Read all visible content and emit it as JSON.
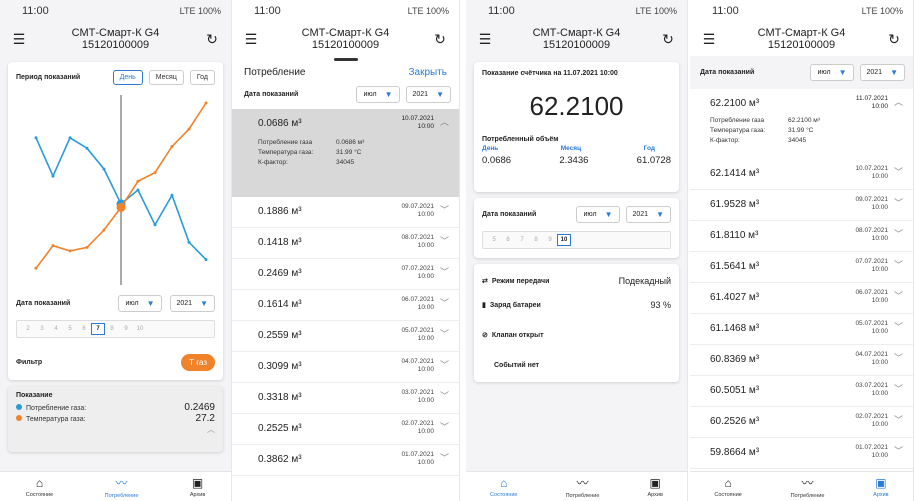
{
  "device": "СМТ-Смарт-К G4",
  "serial": "15120100009",
  "status": {
    "time": "11:00",
    "net": "LTE 100%"
  },
  "screen1": {
    "period_label": "Период показаний",
    "tabs": [
      "День",
      "Месяц",
      "Год"
    ],
    "date_label": "Дата показаний",
    "month": "июл",
    "year": "2021",
    "days": [
      "2",
      "3",
      "4",
      "5",
      "6",
      "7",
      "8",
      "9",
      "10"
    ],
    "active_day": "7",
    "filter_label": "Фильтр",
    "filter_button": "Т газ",
    "reading_title": "Показание",
    "readings": [
      {
        "name": "Потребление газа:",
        "value": "0.2469",
        "color": "#2a9bd8"
      },
      {
        "name": "Температура газа:",
        "value": "27.2",
        "color": "#f0822a"
      }
    ],
    "chart_data": {
      "type": "line",
      "series": [
        {
          "color": "#2a9bd8",
          "values": [
            0.8,
            0.58,
            0.8,
            0.74,
            0.62,
            0.42,
            0.5,
            0.3,
            0.47,
            0.2,
            0.1
          ]
        },
        {
          "color": "#f0822a",
          "values": [
            0.05,
            0.18,
            0.15,
            0.17,
            0.27,
            0.4,
            0.55,
            0.6,
            0.75,
            0.85,
            1.0
          ]
        }
      ]
    }
  },
  "screen2": {
    "title": "Потребление",
    "close": "Закрыть",
    "date_label": "Дата показаний",
    "month": "июл",
    "year": "2021",
    "expanded": {
      "value": "0.0686 м³",
      "date": "10.07.2021",
      "time": "10:00",
      "details": [
        {
          "k": "Потребление газа",
          "v": "0.0686 м³"
        },
        {
          "k": "Температура газа:",
          "v": "31.99 °C"
        },
        {
          "k": "К-фактор:",
          "v": "34045"
        }
      ]
    },
    "rows": [
      {
        "value": "0.1886 м³",
        "date": "09.07.2021",
        "time": "10:00"
      },
      {
        "value": "0.1418 м³",
        "date": "08.07.2021",
        "time": "10:00"
      },
      {
        "value": "0.2469 м³",
        "date": "07.07.2021",
        "time": "10:00"
      },
      {
        "value": "0.1614 м³",
        "date": "06.07.2021",
        "time": "10:00"
      },
      {
        "value": "0.2559 м³",
        "date": "05.07.2021",
        "time": "10:00"
      },
      {
        "value": "0.3099 м³",
        "date": "04.07.2021",
        "time": "10:00"
      },
      {
        "value": "0.3318 м³",
        "date": "03.07.2021",
        "time": "10:00"
      },
      {
        "value": "0.2525 м³",
        "date": "02.07.2021",
        "time": "10:00"
      },
      {
        "value": "0.3862 м³",
        "date": "01.07.2021",
        "time": "10:00"
      }
    ]
  },
  "screen3": {
    "meter_label": "Показание счётчика на 11.07.2021 10:00",
    "meter_value": "62.2100",
    "volume_label": "Потребленный объём",
    "cols": [
      {
        "h": "День",
        "v": "0.0686"
      },
      {
        "h": "Месяц",
        "v": "2.3436"
      },
      {
        "h": "Год",
        "v": "61.0728"
      }
    ],
    "date_label": "Дата показаний",
    "month": "июл",
    "year": "2021",
    "days": [
      "5",
      "6",
      "7",
      "8",
      "9",
      "10"
    ],
    "active_day": "10",
    "mode_label": "Режим передачи",
    "mode_value": "Подекадный",
    "battery_label": "Заряд батареи",
    "battery_value": "93 %",
    "valve_label": "Клапан открыт",
    "events_label": "Событий нет"
  },
  "screen4": {
    "date_label": "Дата показаний",
    "month": "июл",
    "year": "2021",
    "expanded": {
      "value": "62.2100 м³",
      "date": "11.07.2021",
      "time": "10:00",
      "details": [
        {
          "k": "Потребление газа",
          "v": "62.2100 м³"
        },
        {
          "k": "Температура газа:",
          "v": "31.99 °C"
        },
        {
          "k": "К-фактор:",
          "v": "34045"
        }
      ]
    },
    "rows": [
      {
        "value": "62.1414 м³",
        "date": "10.07.2021",
        "time": "10:00"
      },
      {
        "value": "61.9528 м³",
        "date": "09.07.2021",
        "time": "10:00"
      },
      {
        "value": "61.8110 м³",
        "date": "08.07.2021",
        "time": "10:00"
      },
      {
        "value": "61.5641 м³",
        "date": "07.07.2021",
        "time": "10:00"
      },
      {
        "value": "61.4027 м³",
        "date": "06.07.2021",
        "time": "10:00"
      },
      {
        "value": "61.1468 м³",
        "date": "05.07.2021",
        "time": "10:00"
      },
      {
        "value": "60.8369 м³",
        "date": "04.07.2021",
        "time": "10:00"
      },
      {
        "value": "60.5051 м³",
        "date": "03.07.2021",
        "time": "10:00"
      },
      {
        "value": "60.2526 м³",
        "date": "02.07.2021",
        "time": "10:00"
      },
      {
        "value": "59.8664 м³",
        "date": "01.07.2021",
        "time": "10:00"
      }
    ]
  },
  "nav": [
    "Состояние",
    "Потребление",
    "Архив"
  ]
}
